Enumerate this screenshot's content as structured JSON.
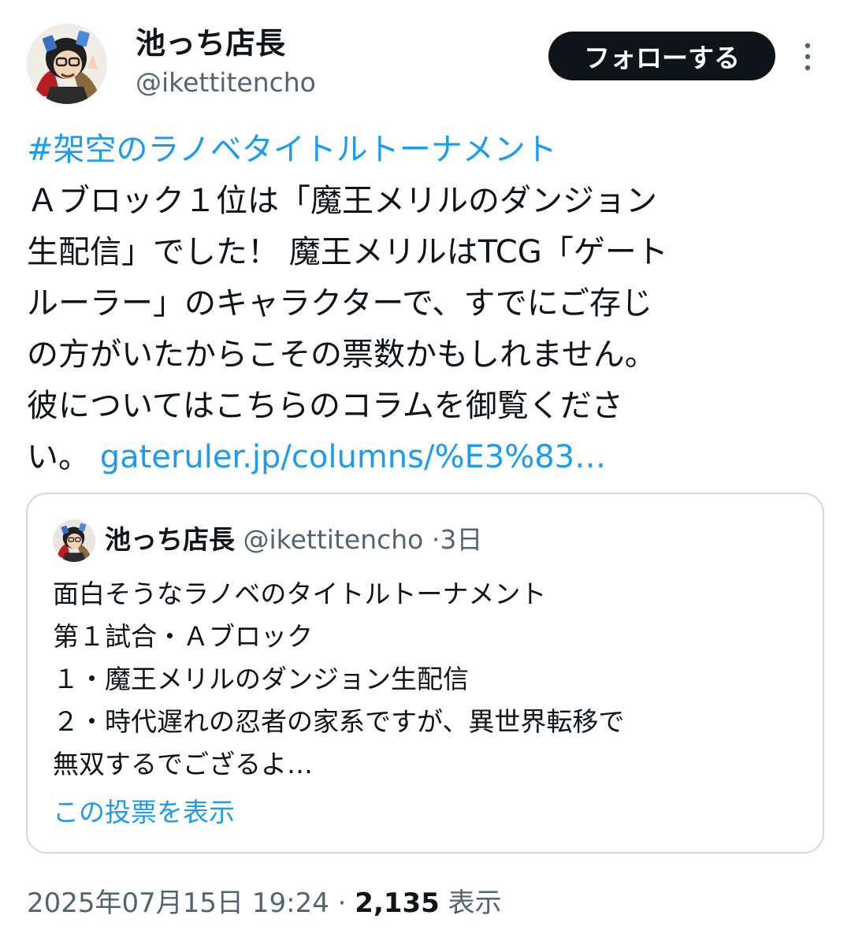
{
  "tweet": {
    "author": {
      "name": "池っち店長",
      "handle": "@ikettitencho"
    },
    "follow_label": "フォローする",
    "more_icon": "more-vertical-icon",
    "body_lines": [
      {
        "parts": [
          {
            "text": "#架空のラノベタイトルトーナメント",
            "type": "hashtag"
          }
        ]
      },
      {
        "parts": [
          {
            "text": "Ａブロック１位は「魔王メリルのダンジョン",
            "type": "text"
          }
        ]
      },
      {
        "parts": [
          {
            "text": "生配信」でした！ 魔王メリルはTCG「ゲート",
            "type": "text"
          }
        ]
      },
      {
        "parts": [
          {
            "text": "ルーラー」のキャラクターで、すでにご存じ",
            "type": "text"
          }
        ]
      },
      {
        "parts": [
          {
            "text": "の方がいたからこその票数かもしれません。",
            "type": "text"
          }
        ]
      },
      {
        "parts": [
          {
            "text": "彼についてはこちらのコラムを御覧くださ",
            "type": "text"
          }
        ]
      },
      {
        "parts": [
          {
            "text": "い。 ",
            "type": "text"
          },
          {
            "text": "gateruler.jp/columns/%E3%83…",
            "type": "link"
          }
        ]
      }
    ],
    "quote": {
      "author_name": "池っち店長",
      "author_handle": "@ikettitencho",
      "separator": "·",
      "time": "3日",
      "lines": [
        "面白そうなラノベのタイトルトーナメント",
        "第１試合・Ａブロック",
        "１・魔王メリルのダンジョン生配信",
        "２・時代遅れの忍者の家系ですが、異世界転移で",
        "無双するでござるよ…"
      ],
      "show_poll_label": "この投票を表示"
    },
    "footer": {
      "timestamp": "2025年07月15日 19:24",
      "separator": "·",
      "view_count": "2,135",
      "view_label": "表示"
    }
  },
  "colors": {
    "text": "#0f1419",
    "secondary": "#536471",
    "link": "#1d9bf0",
    "border": "#cfd9de",
    "button_bg": "#0f1419",
    "button_text": "#ffffff"
  }
}
